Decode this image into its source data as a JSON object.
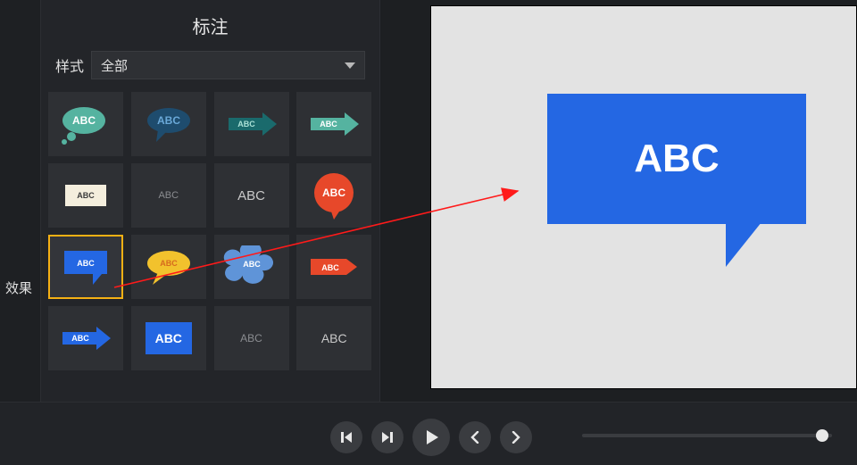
{
  "leftRail": {
    "effectsLabel": "效果"
  },
  "panel": {
    "title": "标注",
    "styleLabel": "样式",
    "dropdown": {
      "value": "全部"
    }
  },
  "grid": {
    "label": "ABC",
    "items": [
      {
        "id": "thought-teal"
      },
      {
        "id": "oval-navy"
      },
      {
        "id": "arrow-teal-dark"
      },
      {
        "id": "arrow-teal-solid"
      },
      {
        "id": "rect-cream"
      },
      {
        "id": "text-plain-1"
      },
      {
        "id": "text-plain-2"
      },
      {
        "id": "oval-orange"
      },
      {
        "id": "rect-callout-blue",
        "selected": true
      },
      {
        "id": "oval-yellow"
      },
      {
        "id": "thought-ltblue"
      },
      {
        "id": "arrow-orange-tag"
      },
      {
        "id": "arrow-blue-solid"
      },
      {
        "id": "rect-blue"
      },
      {
        "id": "text-plain-3"
      },
      {
        "id": "text-plain-4"
      }
    ]
  },
  "preview": {
    "text": "ABC"
  },
  "playbar": {
    "buttons": [
      "step-back",
      "step-fwd",
      "play",
      "prev",
      "next"
    ]
  },
  "colors": {
    "teal": "#55b3a0",
    "navy": "#1e4c6e",
    "tealDark": "#1a6a6c",
    "cream": "#f4eedd",
    "orange": "#e7482a",
    "blue": "#2467e3",
    "yellow": "#f2c22d",
    "lightBlue": "#5f94d8",
    "orangeTag": "#e7482a"
  }
}
